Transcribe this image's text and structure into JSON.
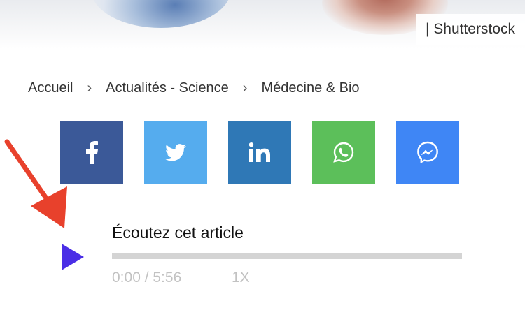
{
  "hero": {
    "credit": "| Shutterstock"
  },
  "breadcrumb": {
    "items": [
      "Accueil",
      "Actualités - Science",
      "Médecine & Bio"
    ],
    "separator": "›"
  },
  "share": {
    "buttons": [
      {
        "network": "facebook",
        "icon": "facebook-icon",
        "color": "#3b5998"
      },
      {
        "network": "twitter",
        "icon": "twitter-icon",
        "color": "#55acee"
      },
      {
        "network": "linkedin",
        "icon": "linkedin-icon",
        "color": "#2f78b6"
      },
      {
        "network": "whatsapp",
        "icon": "whatsapp-icon",
        "color": "#5cbf5a"
      },
      {
        "network": "messenger",
        "icon": "messenger-icon",
        "color": "#3f86f5"
      }
    ]
  },
  "player": {
    "title": "Écoutez cet article",
    "time": "0:00 / 5:56",
    "speed": "1X",
    "progress": 0,
    "play_icon": "play-icon",
    "accent": "#4a2ee6"
  },
  "annotation": {
    "icon": "arrow-icon",
    "color": "#e8412c"
  }
}
